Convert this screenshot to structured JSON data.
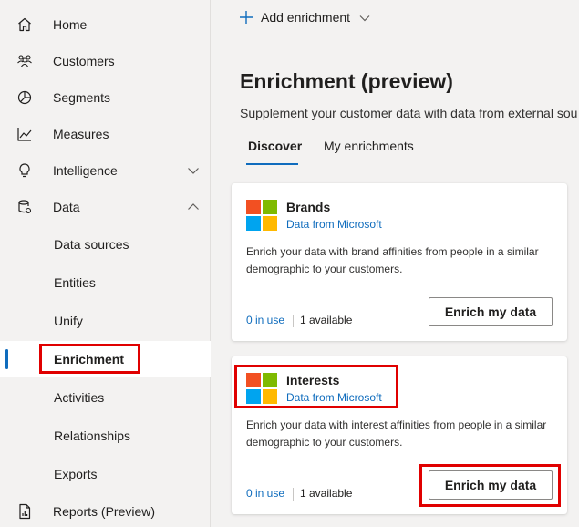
{
  "sidebar": {
    "items": [
      {
        "label": "Home",
        "icon": "home-icon"
      },
      {
        "label": "Customers",
        "icon": "customers-icon"
      },
      {
        "label": "Segments",
        "icon": "segments-icon"
      },
      {
        "label": "Measures",
        "icon": "measures-icon"
      },
      {
        "label": "Intelligence",
        "icon": "intelligence-icon"
      },
      {
        "label": "Data",
        "icon": "data-icon"
      }
    ],
    "data_children": [
      {
        "label": "Data sources"
      },
      {
        "label": "Entities"
      },
      {
        "label": "Unify"
      },
      {
        "label": "Enrichment"
      },
      {
        "label": "Activities"
      },
      {
        "label": "Relationships"
      },
      {
        "label": "Exports"
      }
    ],
    "reports": {
      "label": "Reports (Preview)",
      "icon": "reports-icon"
    },
    "selected": "Enrichment"
  },
  "commandbar": {
    "add_label": "Add enrichment"
  },
  "page": {
    "title": "Enrichment (preview)",
    "subtitle": "Supplement your customer data with data from external sou"
  },
  "tabs": [
    {
      "label": "Discover"
    },
    {
      "label": "My enrichments"
    }
  ],
  "cards": [
    {
      "title": "Brands",
      "source": "Data from Microsoft",
      "description": "Enrich your data with brand affinities from people in a similar demographic to your customers.",
      "in_use": "0 in use",
      "available": "1 available",
      "button": "Enrich my data"
    },
    {
      "title": "Interests",
      "source": "Data from Microsoft",
      "description": "Enrich your data with interest affinities from people in a similar demographic to your customers.",
      "in_use": "0 in use",
      "available": "1 available",
      "button": "Enrich my data"
    }
  ],
  "colors": {
    "accent": "#0f6cbd",
    "highlight": "#e00000",
    "ms_red": "#f25022",
    "ms_green": "#7fba00",
    "ms_blue": "#00a4ef",
    "ms_yellow": "#ffb900"
  }
}
